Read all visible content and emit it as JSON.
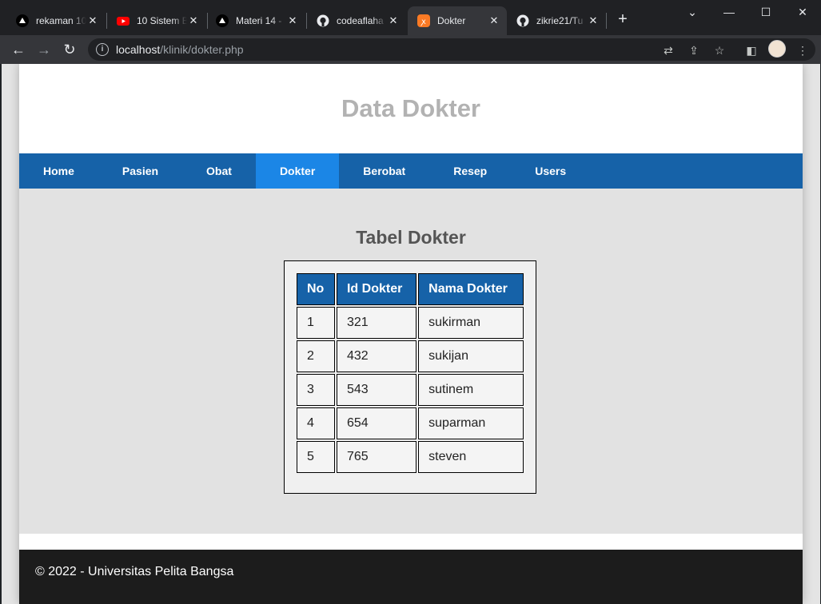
{
  "browser": {
    "tabs": [
      {
        "title": "rekaman 10",
        "icon": "vercel-icon",
        "active": false
      },
      {
        "title": "10 Sistem B",
        "icon": "youtube-icon",
        "active": false
      },
      {
        "title": "Materi 14 -",
        "icon": "vercel-icon",
        "active": false
      },
      {
        "title": "codeaflaha",
        "icon": "github-icon",
        "active": false
      },
      {
        "title": "Dokter",
        "icon": "xampp-icon",
        "active": true
      },
      {
        "title": "zikrie21/Tu",
        "icon": "github-icon",
        "active": false
      }
    ],
    "url_host": "localhost",
    "url_path": "/klinik/dokter.php"
  },
  "page": {
    "title": "Data Dokter",
    "nav": [
      "Home",
      "Pasien",
      "Obat",
      "Dokter",
      "Berobat",
      "Resep",
      "Users"
    ],
    "active_nav": "Dokter",
    "table_title": "Tabel Dokter",
    "columns": [
      "No",
      "Id Dokter",
      "Nama Dokter"
    ],
    "rows": [
      [
        "1",
        "321",
        "sukirman"
      ],
      [
        "2",
        "432",
        "sukijan"
      ],
      [
        "3",
        "543",
        "sutinem"
      ],
      [
        "4",
        "654",
        "suparman"
      ],
      [
        "5",
        "765",
        "steven"
      ]
    ],
    "footer": "© 2022 - Universitas Pelita Bangsa"
  },
  "colors": {
    "nav_bg": "#1662a8",
    "nav_active": "#1b86e6",
    "footer_bg": "#1c1c1c"
  }
}
